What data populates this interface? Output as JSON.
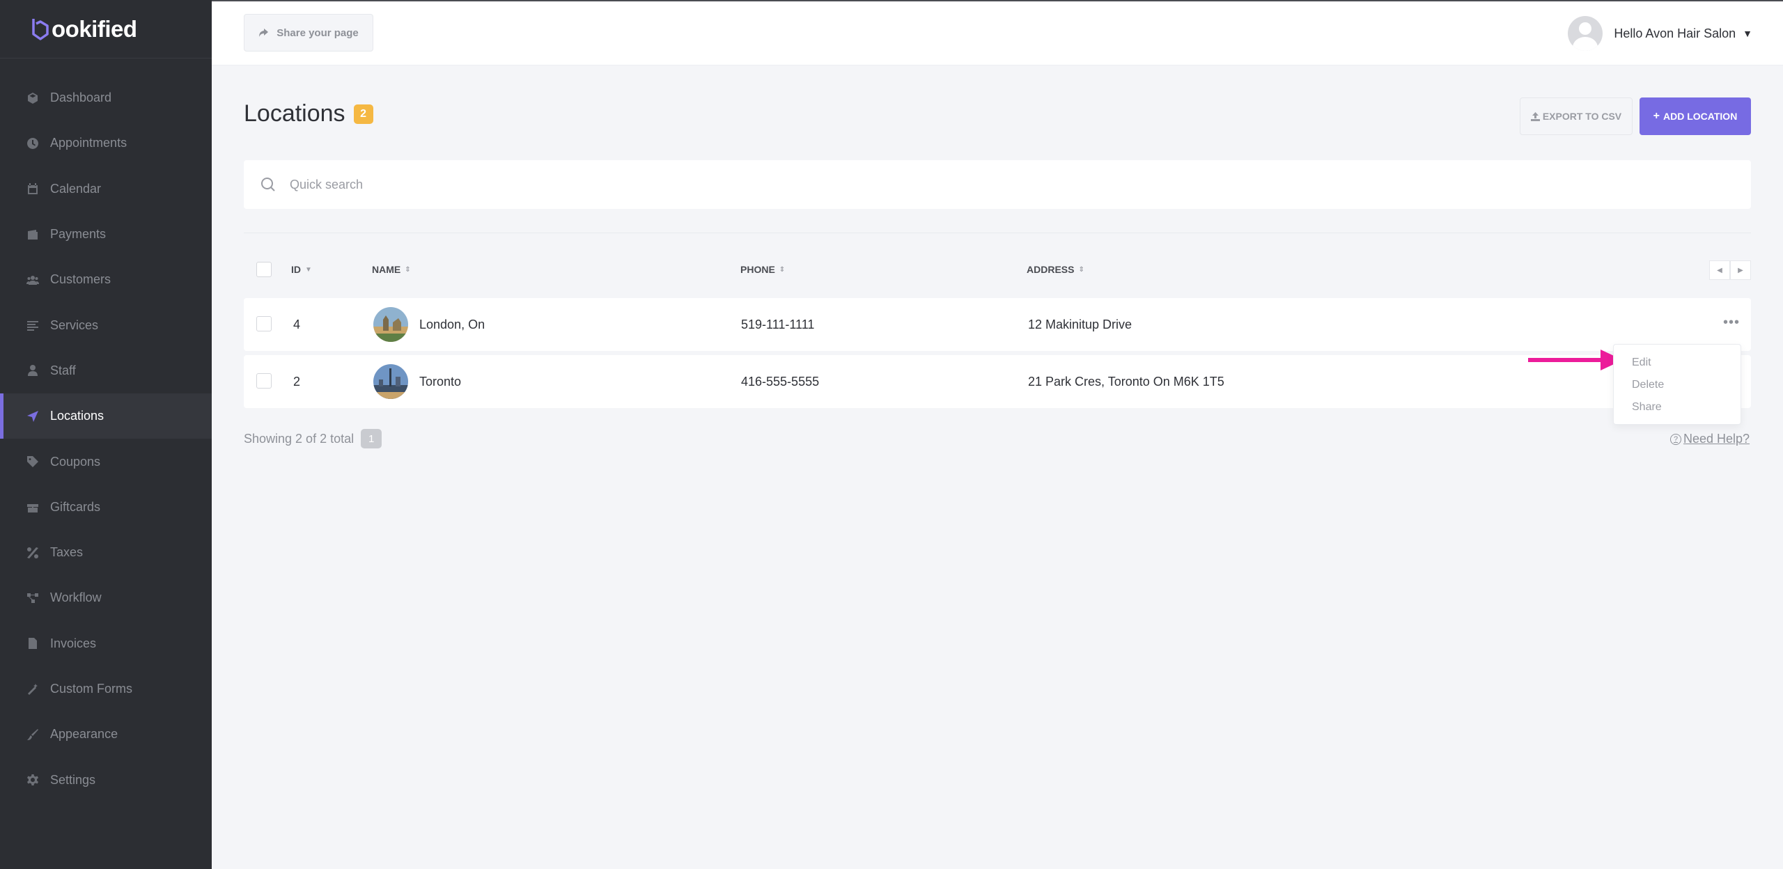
{
  "brand": {
    "logo_text": "ookified"
  },
  "sidebar": {
    "items": [
      {
        "label": "Dashboard",
        "icon": "box-icon"
      },
      {
        "label": "Appointments",
        "icon": "clock-icon"
      },
      {
        "label": "Calendar",
        "icon": "calendar-icon"
      },
      {
        "label": "Payments",
        "icon": "wallet-icon"
      },
      {
        "label": "Customers",
        "icon": "users-icon"
      },
      {
        "label": "Services",
        "icon": "list-icon"
      },
      {
        "label": "Staff",
        "icon": "user-icon"
      },
      {
        "label": "Locations",
        "icon": "location-arrow-icon",
        "active": true
      },
      {
        "label": "Coupons",
        "icon": "tag-icon"
      },
      {
        "label": "Giftcards",
        "icon": "gift-icon"
      },
      {
        "label": "Taxes",
        "icon": "percent-icon"
      },
      {
        "label": "Workflow",
        "icon": "workflow-icon"
      },
      {
        "label": "Invoices",
        "icon": "file-icon"
      },
      {
        "label": "Custom Forms",
        "icon": "wand-icon"
      },
      {
        "label": "Appearance",
        "icon": "brush-icon"
      },
      {
        "label": "Settings",
        "icon": "gear-icon"
      }
    ]
  },
  "topbar": {
    "share_label": "Share your page",
    "user_greeting": "Hello Avon Hair Salon"
  },
  "page": {
    "title": "Locations",
    "count": "2",
    "export_label": "EXPORT TO CSV",
    "add_label": "ADD LOCATION"
  },
  "search": {
    "placeholder": "Quick search"
  },
  "table": {
    "columns": {
      "id": "ID",
      "name": "NAME",
      "phone": "PHONE",
      "address": "ADDRESS"
    },
    "rows": [
      {
        "id": "4",
        "name": "London, On",
        "phone": "519-111-1111",
        "address": "12 Makinitup Drive"
      },
      {
        "id": "2",
        "name": "Toronto",
        "phone": "416-555-5555",
        "address": "21 Park Cres, Toronto On M6K 1T5"
      }
    ]
  },
  "row_menu": {
    "edit": "Edit",
    "delete": "Delete",
    "share": "Share"
  },
  "footer": {
    "showing": "Showing 2 of 2 total",
    "page": "1",
    "help": "Need Help?"
  },
  "colors": {
    "accent": "#776be3",
    "sidebar_bg": "#2c2e33",
    "badge": "#f5b843",
    "annotation_arrow": "#ec1c9a"
  }
}
